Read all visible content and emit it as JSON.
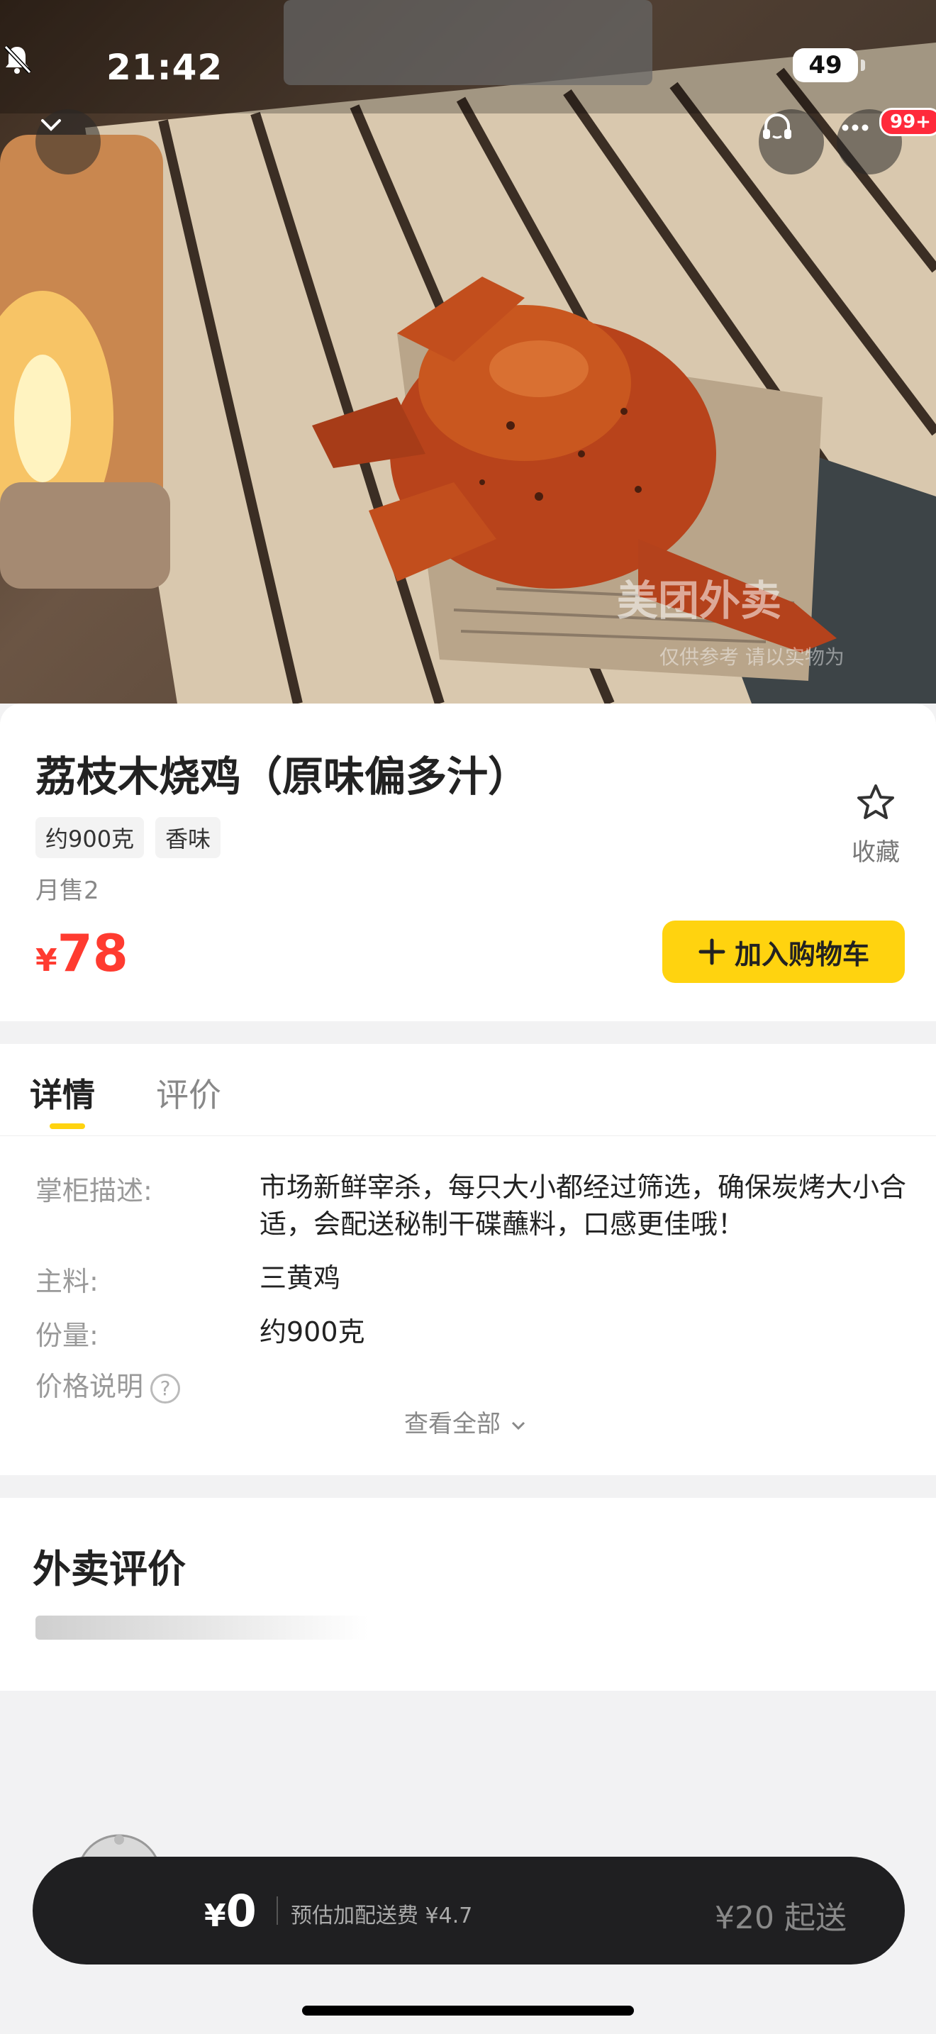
{
  "status_bar": {
    "time": "21:42",
    "battery": "49"
  },
  "header": {
    "notification_badge": "99+"
  },
  "hero": {
    "watermark": "美团外卖",
    "watermark_note": "仅供参考 请以实物为"
  },
  "product": {
    "title": "荔枝木烧鸡（原味偏多汁）",
    "tags": [
      "约900克",
      "香味"
    ],
    "sales": "月售2",
    "currency": "¥",
    "price": "78",
    "favorite_label": "收藏",
    "add_to_cart_label": "加入购物车"
  },
  "tabs": {
    "details": "详情",
    "reviews": "评价"
  },
  "details": {
    "rows": [
      {
        "key": "掌柜描述:",
        "value": "市场新鲜宰杀，每只大小都经过筛选，确保炭烤大小合适，会配送秘制干碟蘸料，口感更佳哦！"
      },
      {
        "key": "主料:",
        "value": "三黄鸡"
      },
      {
        "key": "份量:",
        "value": "约900克"
      },
      {
        "key": "价格说明",
        "value": ""
      }
    ],
    "view_all": "查看全部"
  },
  "reviews": {
    "title": "外卖评价"
  },
  "cart": {
    "currency": "¥",
    "total": "0",
    "estimate": "预估加配送费 ¥4.7",
    "minimum": "¥20 起送"
  },
  "colors": {
    "accent_yellow": "#ffd30f",
    "price_red": "#ff3b30",
    "cart_bg": "#1f1f21",
    "badge_red": "#ff2a3b"
  },
  "icons": [
    "chevron-down-icon",
    "headset-icon",
    "more-icon",
    "star-icon",
    "plus-icon",
    "question-icon",
    "wifi-icon",
    "signal-icon",
    "bell-off-icon"
  ]
}
